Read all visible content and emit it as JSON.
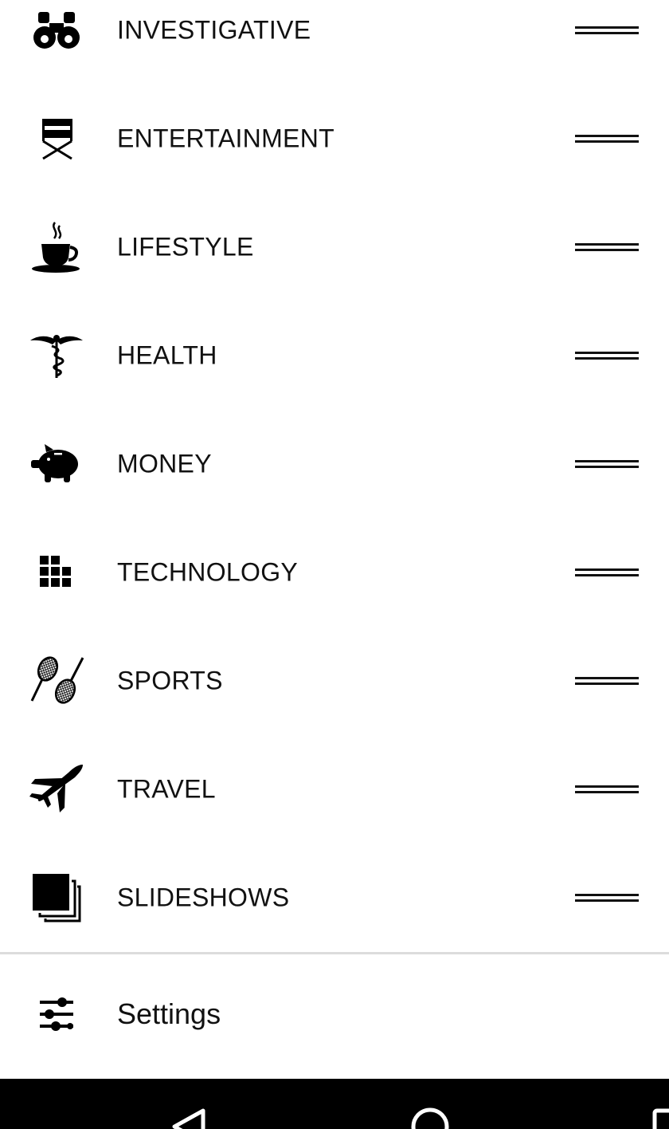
{
  "menu": {
    "items": [
      {
        "label": "INVESTIGATIVE",
        "icon": "binoculars-icon"
      },
      {
        "label": "ENTERTAINMENT",
        "icon": "directors-chair-icon"
      },
      {
        "label": "LIFESTYLE",
        "icon": "coffee-cup-icon"
      },
      {
        "label": "HEALTH",
        "icon": "caduceus-icon"
      },
      {
        "label": "MONEY",
        "icon": "piggy-bank-icon"
      },
      {
        "label": "TECHNOLOGY",
        "icon": "grid-blocks-icon"
      },
      {
        "label": "SPORTS",
        "icon": "tennis-rackets-icon"
      },
      {
        "label": "TRAVEL",
        "icon": "airplane-icon"
      },
      {
        "label": "SLIDESHOWS",
        "icon": "stacked-squares-icon"
      }
    ]
  },
  "settings": {
    "label": "Settings",
    "icon": "sliders-icon"
  },
  "nav_bar": {
    "buttons": [
      "back-icon",
      "home-icon",
      "recents-icon"
    ]
  },
  "colors": {
    "text": "#111111",
    "background": "#ffffff",
    "divider": "#dcdcdc",
    "nav_bar": "#000000"
  }
}
